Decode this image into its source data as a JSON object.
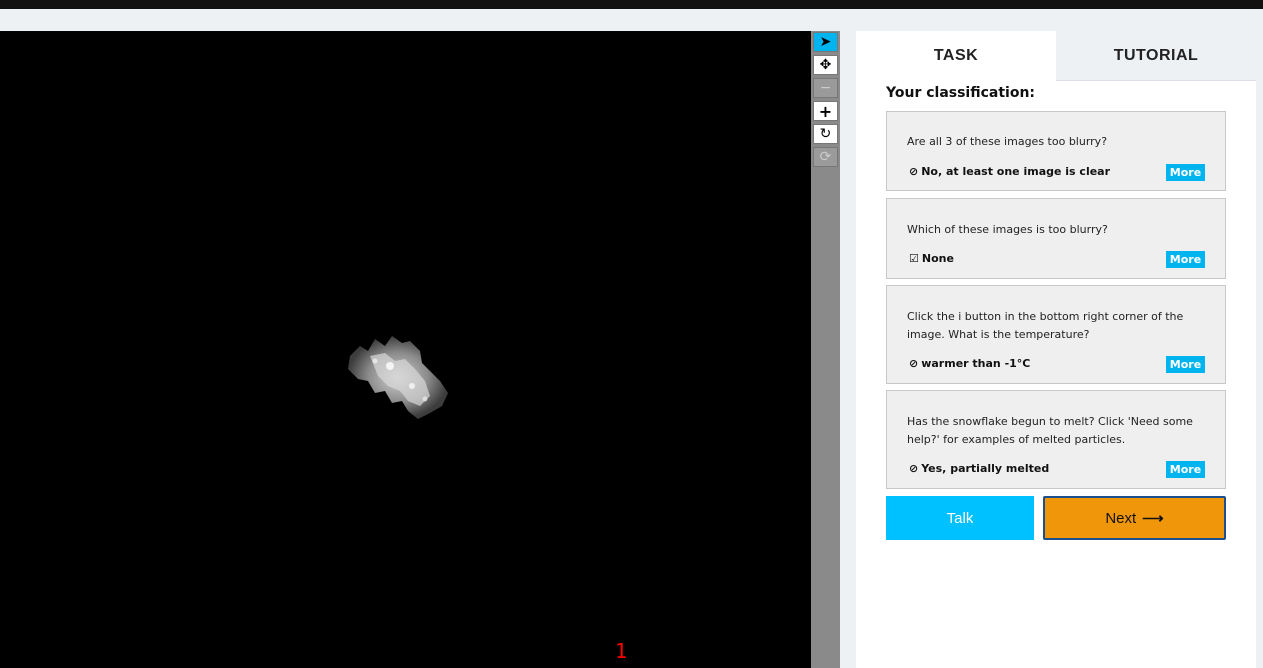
{
  "viewer": {
    "frame_number": "1"
  },
  "toolbar": {
    "tools": [
      {
        "name": "pointer-icon",
        "glyph": "➤"
      },
      {
        "name": "move-icon",
        "glyph": "✥"
      },
      {
        "name": "zoom-out-icon",
        "glyph": "−"
      },
      {
        "name": "zoom-in-icon",
        "glyph": "+"
      },
      {
        "name": "rotate-icon",
        "glyph": "↻"
      },
      {
        "name": "reset-icon",
        "glyph": "⟳"
      }
    ]
  },
  "tabs": {
    "task": "TASK",
    "tutorial": "TUTORIAL"
  },
  "classification": {
    "heading": "Your classification:",
    "questions": [
      {
        "question": "Are all 3 of these images too blurry?",
        "answer": "No, at least one image is clear",
        "answer_icon": "check-circle-icon",
        "more": "More"
      },
      {
        "question": "Which of these images is too blurry?",
        "answer": "None",
        "answer_icon": "check-square-icon",
        "more": "More"
      },
      {
        "question": "Click the i button in the bottom right corner of the image. What is the temperature?",
        "answer": "warmer than -1°C",
        "answer_icon": "check-circle-icon",
        "more": "More"
      },
      {
        "question": "Has the snowflake begun to melt? Click 'Need some help?' for examples of melted particles.",
        "answer": "Yes, partially melted",
        "answer_icon": "check-circle-icon",
        "more": "More"
      }
    ]
  },
  "actions": {
    "talk": "Talk",
    "next": "Next",
    "next_arrow": "⟶"
  },
  "colors": {
    "accent": "#00b4f0",
    "next_button": "#f0960a"
  }
}
